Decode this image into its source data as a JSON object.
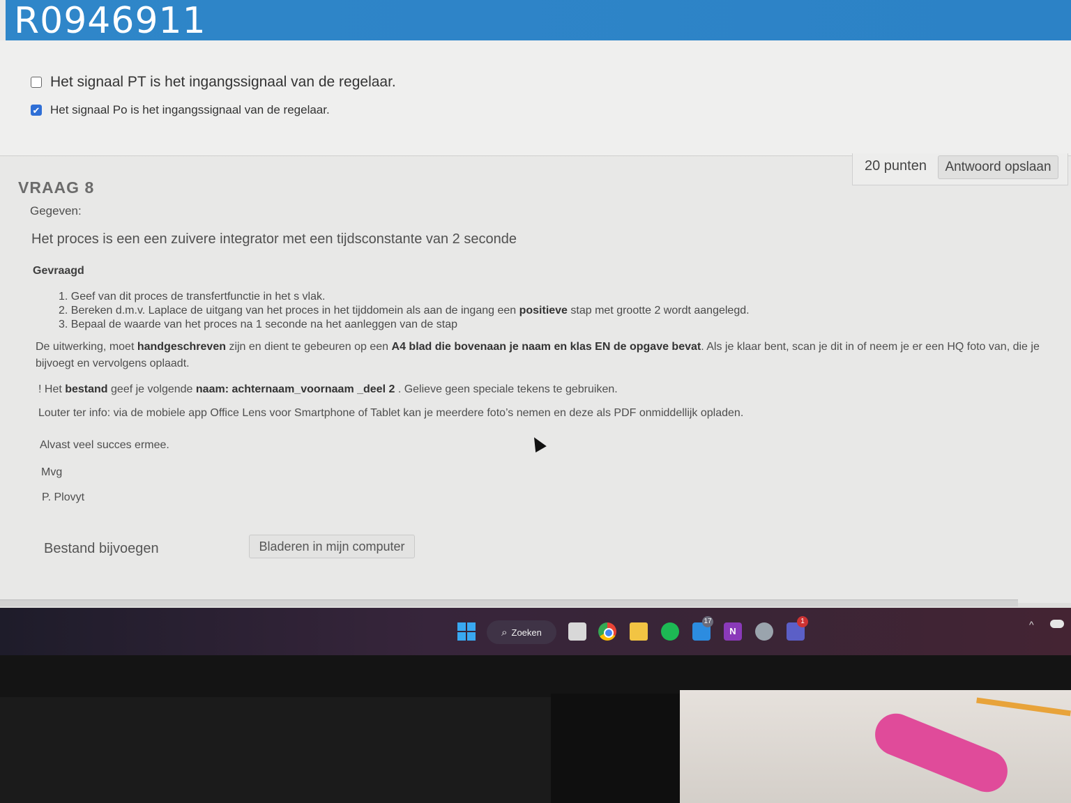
{
  "header": {
    "code": "R0946911"
  },
  "options": [
    {
      "label": "Het signaal PT is het ingangssignaal van de regelaar.",
      "checked": false
    },
    {
      "label": "Het signaal Po is het ingangssignaal van de regelaar.",
      "checked": true
    }
  ],
  "question": {
    "title": "VRAAG 8",
    "points": "20 punten",
    "save_label": "Antwoord opslaan",
    "given_heading": "Gegeven:",
    "given_text": "Het proces is een een zuivere integrator met een tijdsconstante van 2 seconde",
    "asked_heading": "Gevraagd",
    "tasks": [
      "1. Geef van dit proces de transfertfunctie in het s vlak.",
      "3. Bepaal de waarde van het proces na 1 seconde na het aanleggen van de stap"
    ],
    "task2": {
      "a": "2. Bereken d.m.v. Laplace de uitgang van het proces in het tijddomein  als aan de ingang een ",
      "b": "positieve",
      "c": " stap met grootte 2 wordt aangelegd."
    },
    "para1": {
      "a": "De uitwerking, moet ",
      "b": "handgeschreven",
      "c": " zijn en dient te gebeuren op een ",
      "d": "A4 blad  die bovenaan je naam en klas EN de opgave bevat",
      "e": ". Als je klaar bent, scan je dit in of neem je er een HQ foto van, die je bijvoegt en vervolgens oplaadt."
    },
    "para2": {
      "a": "! Het ",
      "b": "bestand",
      "c": " geef je volgende ",
      "d": "naam: achternaam_voornaam _deel 2",
      "e": " . Gelieve geen speciale tekens te gebruiken."
    },
    "para3": "Louter ter info: via de mobiele app Office Lens voor Smartphone of Tablet kan je meerdere foto’s nemen en deze als PDF onmiddellijk opladen.",
    "para4": "Alvast veel succes ermee.",
    "para5": "Mvg",
    "para6": "P. Plovyt",
    "attach_label": "Bestand bijvoegen",
    "browse_label": "Bladeren in mijn computer"
  },
  "taskbar": {
    "search_label": "Zoeken",
    "icons": [
      "windows-start-icon",
      "file-explorer-icon",
      "chrome-icon",
      "folder-icon",
      "spotify-icon",
      "mail-icon",
      "onenote-icon",
      "settings-icon",
      "teams-icon"
    ],
    "onenote_letter": "N",
    "badge_mail": "17",
    "badge_teams": "1"
  },
  "colors": {
    "header_blue": "#2f86c9",
    "checkbox_blue": "#2f6fd6"
  }
}
